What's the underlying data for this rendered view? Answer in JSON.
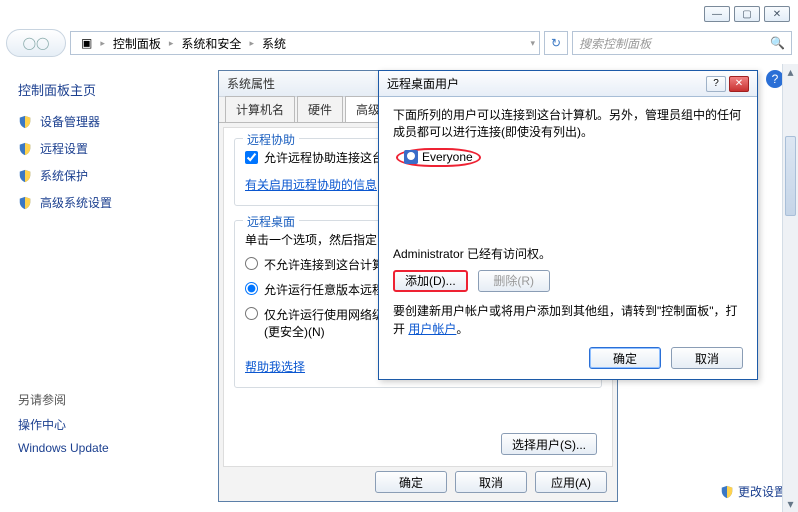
{
  "window_controls": {
    "min": "—",
    "max": "▢",
    "close": "✕"
  },
  "breadcrumb": {
    "icon": "▣",
    "items": [
      "控制面板",
      "系统和安全",
      "系统"
    ]
  },
  "search": {
    "placeholder": "搜索控制面板"
  },
  "sidebar": {
    "title": "控制面板主页",
    "items": [
      {
        "label": "设备管理器"
      },
      {
        "label": "远程设置"
      },
      {
        "label": "系统保护"
      },
      {
        "label": "高级系统设置"
      }
    ],
    "see_also": "另请参阅",
    "sa_items": [
      "操作中心",
      "Windows Update"
    ]
  },
  "props": {
    "title": "系统属性",
    "tabs": [
      "计算机名",
      "硬件",
      "高级"
    ],
    "group1_title": "远程协助",
    "checkbox_label": "允许远程协助连接这台",
    "info_link": "有关启用远程协助的信息",
    "group2_title": "远程桌面",
    "group2_desc": "单击一个选项，然后指定",
    "radio1": "不允许连接到这台计算",
    "radio2": "允许运行任意版本远程",
    "radio3": "仅允许运行使用网络级别身份验证的远程桌面的计算机连接(更安全)(N)",
    "help_link": "帮助我选择",
    "select_users_btn": "选择用户(S)...",
    "ok": "确定",
    "cancel": "取消",
    "apply": "应用(A)"
  },
  "rdp": {
    "title": "远程桌面用户",
    "desc": "下面所列的用户可以连接到这台计算机。另外，管理员组中的任何成员都可以进行连接(即使没有列出)。",
    "user": "Everyone",
    "admin_line": "Administrator 已经有访问权。",
    "add": "添加(D)...",
    "remove": "删除(R)",
    "hint_pre": "要创建新用户帐户或将用户添加到其他组，请转到\"控制面板\"，打开",
    "hint_link": "用户帐户",
    "hint_post": "。",
    "ok": "确定",
    "cancel": "取消"
  },
  "change_settings": "更改设置"
}
